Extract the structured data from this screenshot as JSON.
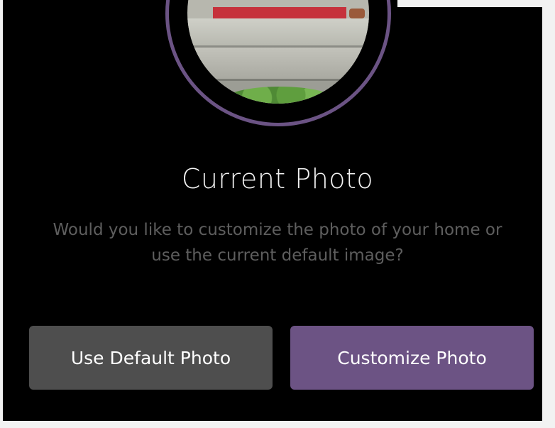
{
  "dialog": {
    "title": "Current Photo",
    "message": "Would you like to customize the photo of your home or use the current default image?"
  },
  "buttons": {
    "default_label": "Use Default Photo",
    "customize_label": "Customize Photo"
  },
  "colors": {
    "background": "#000000",
    "accent": "#6c5384",
    "secondary_button": "#4e4e4e",
    "title_text": "#f2f2f2",
    "message_text": "#5e5e5e"
  }
}
